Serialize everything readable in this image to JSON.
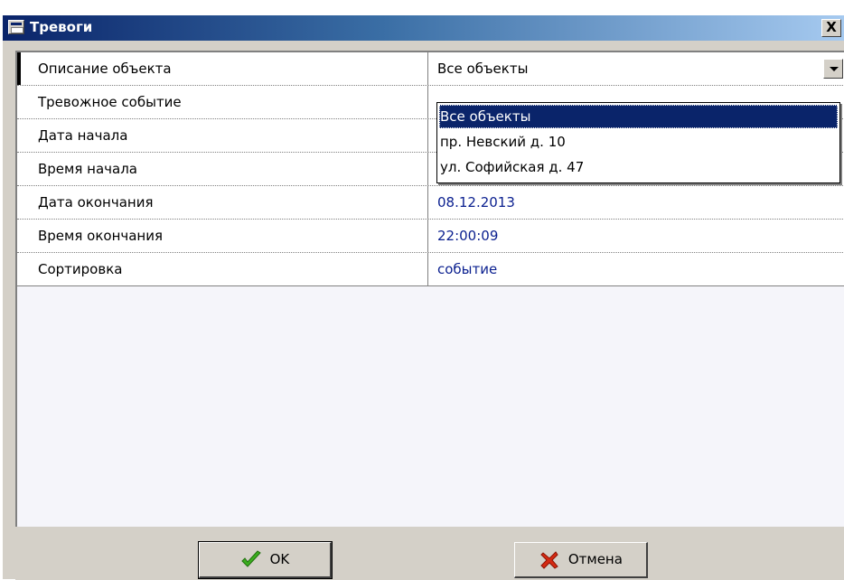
{
  "window": {
    "title": "Тревоги",
    "close_label": "X"
  },
  "properties": [
    {
      "name": "Описание объекта",
      "value": "Все объекты"
    },
    {
      "name": "Тревожное событие",
      "value": ""
    },
    {
      "name": "Дата начала",
      "value": ""
    },
    {
      "name": "Время начала",
      "value": ""
    },
    {
      "name": "Дата окончания",
      "value": "08.12.2013"
    },
    {
      "name": "Время окончания",
      "value": "22:00:09"
    },
    {
      "name": "Сортировка",
      "value": "событие"
    }
  ],
  "dropdown": {
    "options": [
      "Все объекты",
      "пр. Невский д. 10",
      "ул. Софийская д. 47"
    ],
    "selected": "Все объекты"
  },
  "buttons": {
    "ok_label": "OK",
    "cancel_label": "Отмена"
  },
  "colors": {
    "title_start": "#0a246a",
    "title_end": "#a6caf0",
    "selection": "#0a246a",
    "ok_icon": "#3cae1f",
    "cancel_icon": "#d62a12"
  },
  "icons": {
    "window": "window-icon",
    "ok": "checkmark-icon",
    "cancel": "cross-icon",
    "combo": "chevron-down-icon"
  }
}
